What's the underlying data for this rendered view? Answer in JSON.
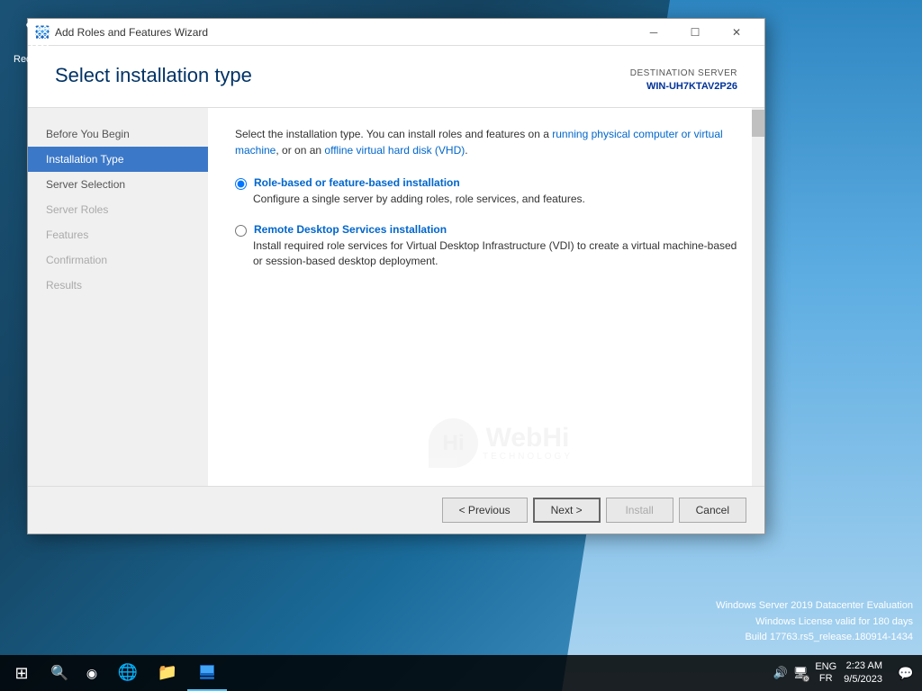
{
  "desktop": {
    "recycle_bin_label": "Recycle Bin"
  },
  "titlebar": {
    "icon": "🖥",
    "title": "Add Roles and Features Wizard",
    "minimize": "─",
    "maximize": "☐",
    "close": "✕"
  },
  "wizard": {
    "header_title": "Select installation type",
    "destination_label": "DESTINATION SERVER",
    "destination_server": "WIN-UH7KTAV2P26",
    "description_part1": "Select the installation type. You can install roles and features on a ",
    "description_link1": "running physical computer or virtual",
    "description_part2": "machine",
    "description_part3": ", or on an ",
    "description_link2": "offline virtual hard disk (VHD)",
    "description_part4": ".",
    "radio1_title": "Role-based or feature-based installation",
    "radio1_desc": "Configure a single server by adding roles, role services, and features.",
    "radio2_title": "Remote Desktop Services installation",
    "radio2_desc": "Install required role services for Virtual Desktop Infrastructure (VDI) to create a virtual machine-based or session-based desktop deployment."
  },
  "nav": {
    "items": [
      {
        "label": "Before You Begin",
        "state": "normal"
      },
      {
        "label": "Installation Type",
        "state": "active"
      },
      {
        "label": "Server Selection",
        "state": "normal"
      },
      {
        "label": "Server Roles",
        "state": "disabled"
      },
      {
        "label": "Features",
        "state": "disabled"
      },
      {
        "label": "Confirmation",
        "state": "disabled"
      },
      {
        "label": "Results",
        "state": "disabled"
      }
    ]
  },
  "footer": {
    "previous": "< Previous",
    "next": "Next >",
    "install": "Install",
    "cancel": "Cancel"
  },
  "watermark": {
    "hi": "Hi",
    "webhi": "WebHi",
    "technology": "TECHNOLOGY"
  },
  "taskbar": {
    "start_icon": "⊞",
    "search_icon": "🔍",
    "lang_top": "ENG",
    "lang_bottom": "FR",
    "time": "2:23 AM",
    "date": "9/5/2023",
    "items": [
      {
        "label": "IE",
        "icon": "🌐"
      },
      {
        "label": "Explorer",
        "icon": "📁"
      },
      {
        "label": "Server Manager",
        "icon": "🖥"
      }
    ]
  },
  "server_info": {
    "line1": "Windows Server 2019 Datacenter Evaluation",
    "line2": "Windows License valid for 180 days",
    "line3": "Build 17763.rs5_release.180914-1434"
  }
}
